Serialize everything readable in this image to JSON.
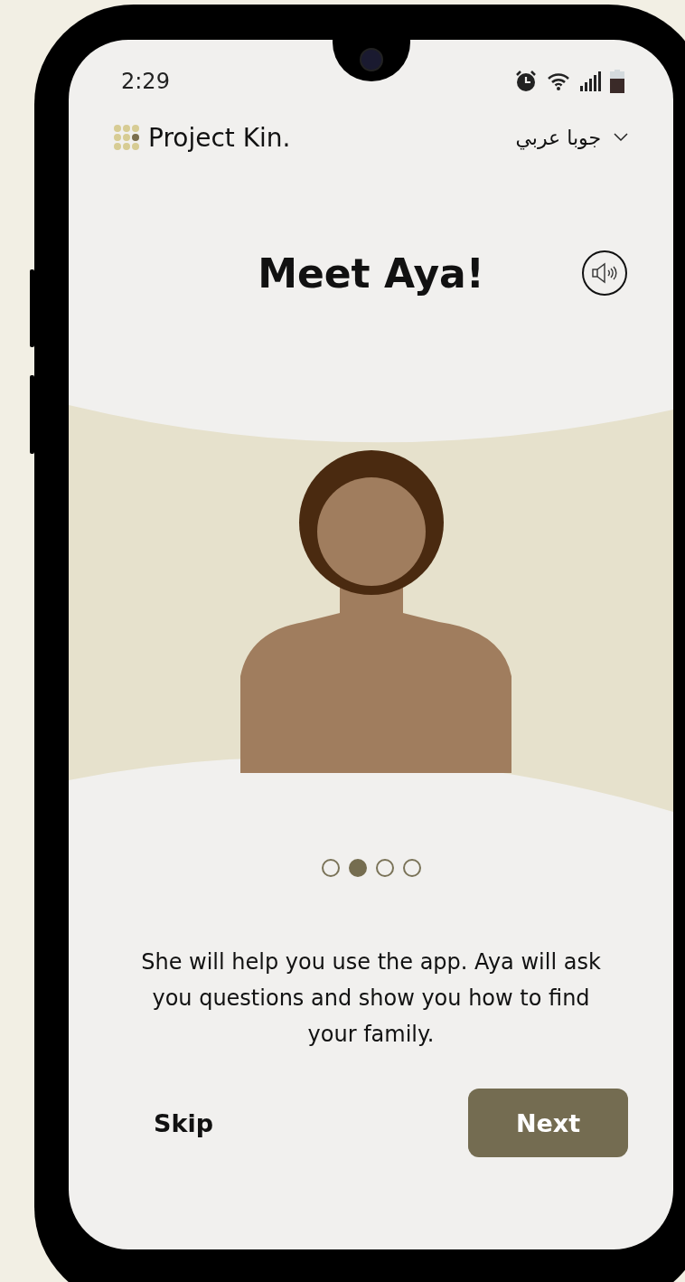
{
  "status_bar": {
    "time": "2:29"
  },
  "header": {
    "brand": "Project Kin.",
    "language": "جوبا عربي"
  },
  "title": "Meet Aya!",
  "pager": [
    {
      "selected": false
    },
    {
      "selected": true
    },
    {
      "selected": false
    },
    {
      "selected": false
    }
  ],
  "description": "She will help you use the app. Aya will ask you questions and show you how to find your family.",
  "buttons": {
    "skip": "Skip",
    "next": "Next"
  }
}
